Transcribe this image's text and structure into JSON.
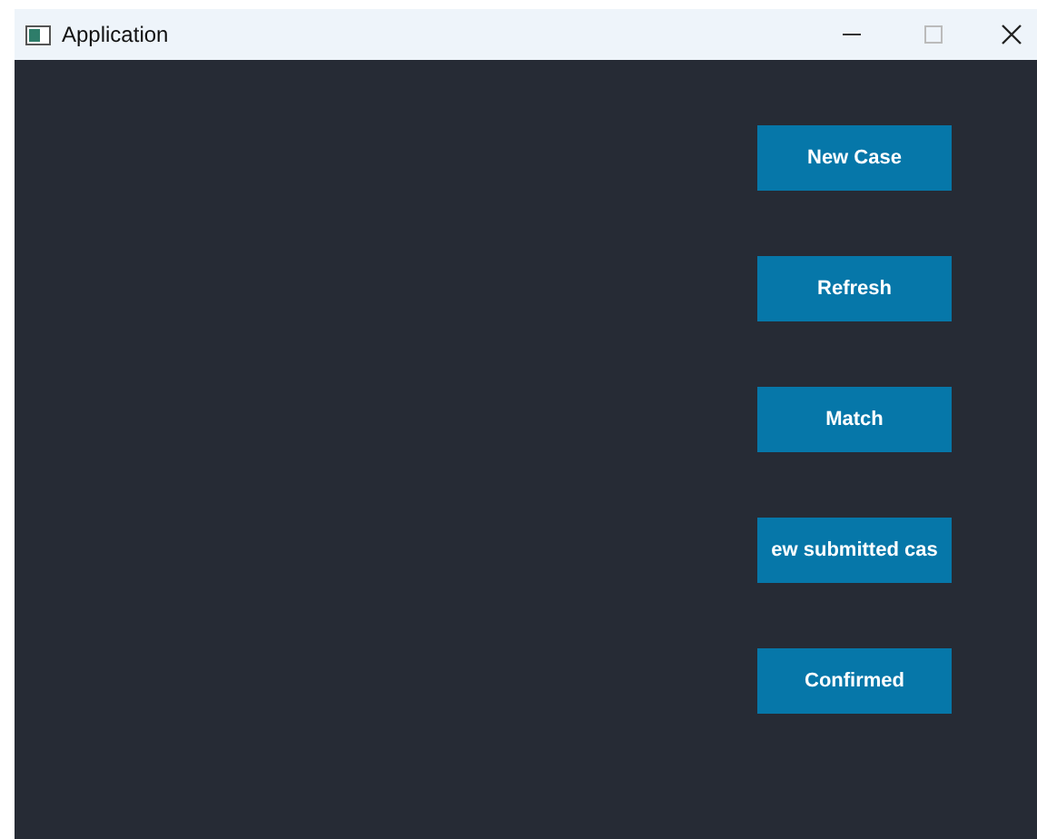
{
  "window": {
    "title": "Application"
  },
  "buttons": [
    {
      "label": "New Case"
    },
    {
      "label": "Refresh"
    },
    {
      "label": "Match"
    },
    {
      "label": "ew submitted cas"
    },
    {
      "label": "Confirmed"
    }
  ]
}
